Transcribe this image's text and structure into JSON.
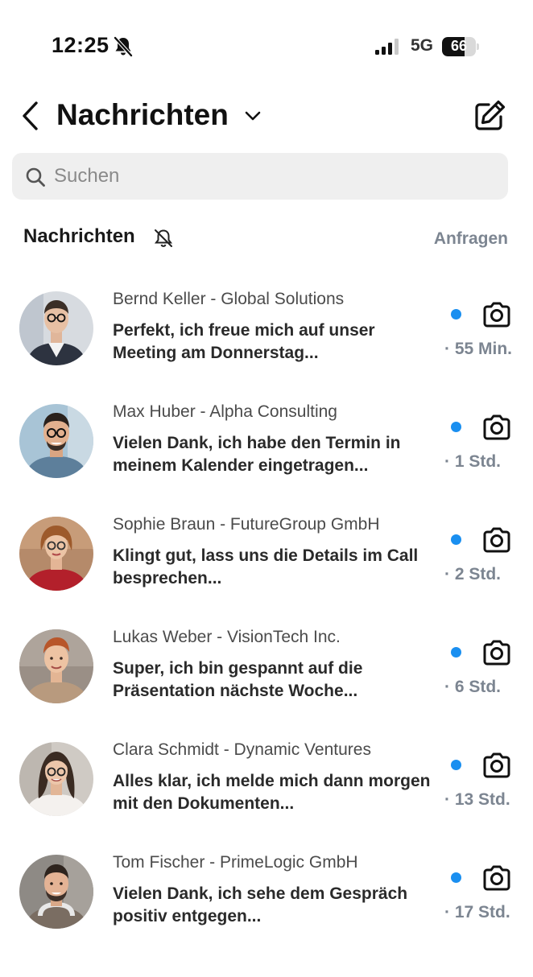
{
  "status_bar": {
    "time": "12:25",
    "network": "5G",
    "battery": "66",
    "battery_level": 0.66
  },
  "header": {
    "title": "Nachrichten"
  },
  "search": {
    "placeholder": "Suchen"
  },
  "section": {
    "title": "Nachrichten",
    "requests_label": "Anfragen"
  },
  "colors": {
    "unread_dot": "#1a8ff0",
    "muted_text": "#7c8591"
  },
  "conversations": [
    {
      "name": "Bernd Keller - Global Solutions",
      "preview": "Perfekt, ich freue mich auf unser Meeting am Donnerstag...",
      "time": "· 55 Min.",
      "unread": true
    },
    {
      "name": "Max Huber - Alpha Consulting",
      "preview": "Vielen Dank, ich habe den Termin in meinem Kalender eingetragen...",
      "time": "· 1 Std.",
      "unread": true
    },
    {
      "name": "Sophie Braun - FutureGroup GmbH",
      "preview": "Klingt gut, lass uns die Details im Call besprechen...",
      "time": "· 2 Std.",
      "unread": true
    },
    {
      "name": "Lukas Weber - VisionTech Inc.",
      "preview": "Super, ich bin gespannt auf die Präsentation nächste Woche...",
      "time": "· 6 Std.",
      "unread": true
    },
    {
      "name": "Clara Schmidt - Dynamic Ventures",
      "preview": "Alles klar, ich melde mich dann morgen mit den Dokumenten...",
      "time": "· 13 Std.",
      "unread": true
    },
    {
      "name": "Tom Fischer - PrimeLogic GmbH",
      "preview": "Vielen Dank, ich sehe dem Gespräch positiv entgegen...",
      "time": "· 17 Std.",
      "unread": true
    }
  ]
}
